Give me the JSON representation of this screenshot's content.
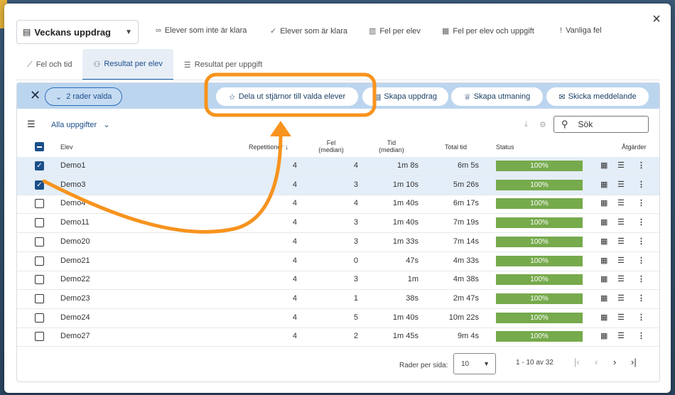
{
  "dialog": {
    "close_icon": "×"
  },
  "assignment_select": {
    "label": "Veckans uppdrag"
  },
  "top_actions": [
    {
      "label": "Elever som inte är klara",
      "icon": "binoculars-icon"
    },
    {
      "label": "Elever som är klara",
      "icon": "check-icon"
    },
    {
      "label": "Fel per elev",
      "icon": "bar-chart-icon"
    },
    {
      "label": "Fel per elev och uppgift",
      "icon": "grid-icon"
    },
    {
      "label": "Vanliga fel",
      "icon": "exclamation-icon"
    }
  ],
  "tabs": [
    {
      "label": "Fel och tid",
      "active": false
    },
    {
      "label": "Resultat per elev",
      "active": true
    },
    {
      "label": "Resultat per uppgift",
      "active": false
    }
  ],
  "selection_bar": {
    "chip": "2 rader valda",
    "buttons": [
      "Dela ut stjärnor till valda elever",
      "Skapa uppdrag",
      "Skapa utmaning",
      "Skicka meddelande"
    ],
    "color": "#bcd5ef"
  },
  "toolbar": {
    "filter_label": "Alla uppgifter",
    "search_placeholder": "Sök"
  },
  "table": {
    "headers": {
      "elev": "Elev",
      "rep": "Repetitioner",
      "fel": "Fel",
      "fel_sub": "(median)",
      "tid": "Tid",
      "tid_sub": "(median)",
      "total": "Total tid",
      "status": "Status",
      "actions": "Åtgärder"
    },
    "rows": [
      {
        "name": "Demo1",
        "rep": "4",
        "fel": "4",
        "tid": "1m 8s",
        "total": "6m 5s",
        "status": "100%",
        "checked": true
      },
      {
        "name": "Demo3",
        "rep": "4",
        "fel": "3",
        "tid": "1m 10s",
        "total": "5m 26s",
        "status": "100%",
        "checked": true
      },
      {
        "name": "Demo4",
        "rep": "4",
        "fel": "4",
        "tid": "1m 40s",
        "total": "6m 17s",
        "status": "100%",
        "checked": false
      },
      {
        "name": "Demo11",
        "rep": "4",
        "fel": "3",
        "tid": "1m 40s",
        "total": "7m 19s",
        "status": "100%",
        "checked": false
      },
      {
        "name": "Demo20",
        "rep": "4",
        "fel": "3",
        "tid": "1m 33s",
        "total": "7m 14s",
        "status": "100%",
        "checked": false
      },
      {
        "name": "Demo21",
        "rep": "4",
        "fel": "0",
        "tid": "47s",
        "total": "4m 33s",
        "status": "100%",
        "checked": false
      },
      {
        "name": "Demo22",
        "rep": "4",
        "fel": "3",
        "tid": "1m",
        "total": "4m 38s",
        "status": "100%",
        "checked": false
      },
      {
        "name": "Demo23",
        "rep": "4",
        "fel": "1",
        "tid": "38s",
        "total": "2m 47s",
        "status": "100%",
        "checked": false
      },
      {
        "name": "Demo24",
        "rep": "4",
        "fel": "5",
        "tid": "1m 40s",
        "total": "10m 22s",
        "status": "100%",
        "checked": false
      },
      {
        "name": "Demo27",
        "rep": "4",
        "fel": "2",
        "tid": "1m 45s",
        "total": "9m 4s",
        "status": "100%",
        "checked": false
      }
    ],
    "status_color": "#76aa4c"
  },
  "pagination": {
    "rows_per_page_label": "Rader per sida:",
    "rows_per_page": "10",
    "range": "1 - 10 av 32"
  },
  "annotation": {
    "color": "#f7931e"
  }
}
